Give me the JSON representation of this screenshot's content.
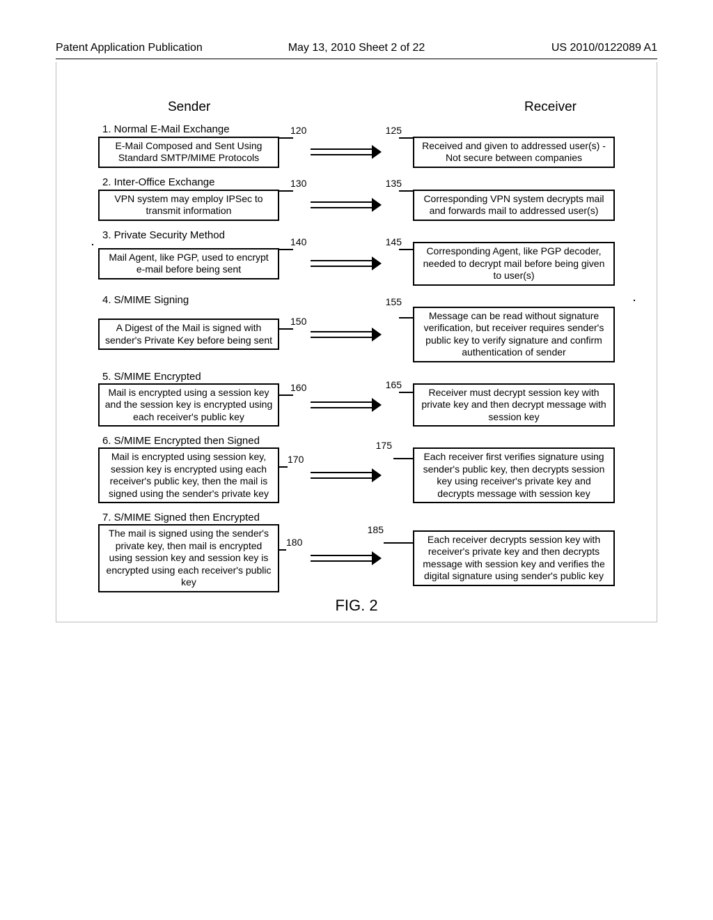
{
  "header": {
    "left": "Patent Application Publication",
    "mid": "May 13, 2010  Sheet 2 of 22",
    "right": "US 2010/0122089 A1"
  },
  "columns": {
    "sender": "Sender",
    "receiver": "Receiver"
  },
  "rows": [
    {
      "title": "1. Normal E-Mail Exchange",
      "senderRef": "120",
      "receiverRef": "125",
      "sender": "E-Mail Composed and Sent Using Standard SMTP/MIME Protocols",
      "receiver": "Received and given to addressed user(s) - Not secure between companies"
    },
    {
      "title": "2. Inter-Office Exchange",
      "senderRef": "130",
      "receiverRef": "135",
      "sender": "VPN system may employ IPSec to transmit information",
      "receiver": "Corresponding VPN system decrypts mail and forwards mail to addressed user(s)"
    },
    {
      "title": "3. Private Security Method",
      "senderRef": "140",
      "receiverRef": "145",
      "sender": "Mail Agent, like PGP, used to encrypt e-mail before being sent",
      "receiver": "Corresponding Agent, like PGP decoder, needed to decrypt mail before being given to user(s)"
    },
    {
      "title": "4. S/MIME Signing",
      "senderRef": "150",
      "receiverRef": "155",
      "sender": "A Digest of the Mail is signed with sender's Private Key before being sent",
      "receiver": "Message can be read without signature verification, but receiver requires sender's public key to verify signature and confirm authentication of sender"
    },
    {
      "title": "5. S/MIME Encrypted",
      "senderRef": "160",
      "receiverRef": "165",
      "sender": "Mail is encrypted using a session key and the session key is encrypted using each receiver's public key",
      "receiver": "Receiver must decrypt session key with private key and then decrypt message with session key"
    },
    {
      "title": "6. S/MIME Encrypted then Signed",
      "senderRef": "170",
      "receiverRef": "175",
      "sender": "Mail is encrypted using session key, session key is encrypted using each receiver's public key, then the mail is signed using the sender's private key",
      "receiver": "Each receiver first verifies signature using sender's public key, then decrypts session key using receiver's private key and decrypts message with session key"
    },
    {
      "title": "7. S/MIME Signed then Encrypted",
      "senderRef": "180",
      "receiverRef": "185",
      "sender": "The mail is signed using the sender's private key, then mail is encrypted using session key and session key is encrypted using each receiver's public key",
      "receiver": "Each receiver decrypts session key with receiver's private key and then decrypts message with session key and verifies the digital signature using sender's public key"
    }
  ],
  "figure_caption": "FIG. 2"
}
